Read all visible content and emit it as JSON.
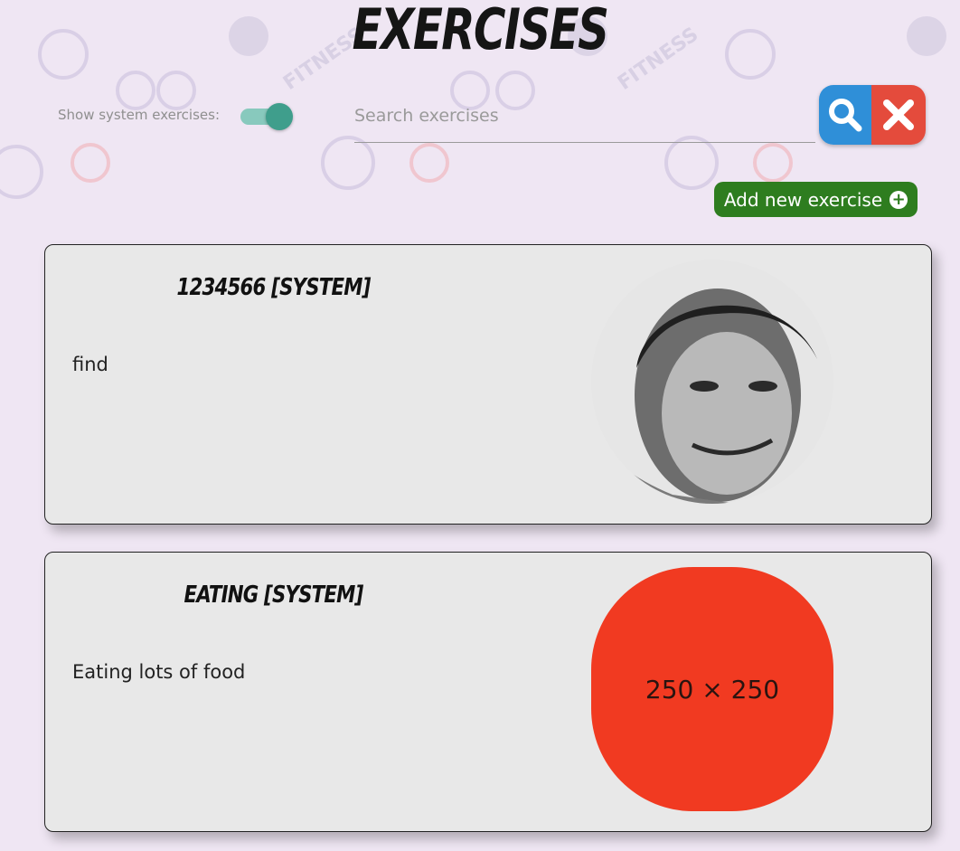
{
  "page": {
    "title": "Exercises"
  },
  "filters": {
    "system_toggle_label": "Show system exercises:",
    "system_toggle_on": true,
    "search_placeholder": "Search exercises"
  },
  "actions": {
    "add_label": "Add new exercise",
    "search_icon": "magnifier-icon",
    "clear_icon": "close-icon"
  },
  "exercises": [
    {
      "title": "1234566 [SYSTEM]",
      "description": "find",
      "image": "portrait-photo"
    },
    {
      "title": "EATING [SYSTEM]",
      "description": "Eating lots of food",
      "image_placeholder": "250 × 250"
    }
  ],
  "colors": {
    "toggle_track": "#88c9bd",
    "toggle_knob": "#3f9e8c",
    "search_button": "#2f8fd8",
    "clear_button": "#e44b3c",
    "add_button": "#2e7d1f",
    "placeholder_bg": "#f13a21"
  }
}
